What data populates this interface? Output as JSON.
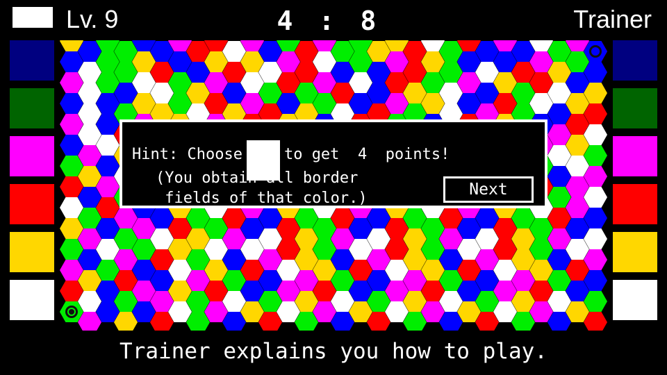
{
  "header": {
    "swatch_color": "#ffffff",
    "level_label": "Lv. 9",
    "score_left": "4",
    "score_separator": ":",
    "score_right": "8",
    "player_name": "Trainer"
  },
  "palette": {
    "colors": [
      "#000080",
      "#006400",
      "#ff00ff",
      "#ff0000",
      "#ffd700",
      "#ffffff"
    ],
    "selected_index": 5,
    "left_items": [
      {
        "name": "swatch-navy",
        "color": "#000080",
        "selected": false
      },
      {
        "name": "swatch-green",
        "color": "#006400",
        "selected": false
      },
      {
        "name": "swatch-magenta",
        "color": "#ff00ff",
        "selected": false
      },
      {
        "name": "swatch-red",
        "color": "#ff0000",
        "selected": false
      },
      {
        "name": "swatch-yellow",
        "color": "#ffd700",
        "selected": false
      },
      {
        "name": "swatch-white",
        "color": "#ffffff",
        "selected": true
      }
    ],
    "right_items": [
      {
        "name": "swatch-navy",
        "color": "#000080",
        "selected": false
      },
      {
        "name": "swatch-green",
        "color": "#006400",
        "selected": false
      },
      {
        "name": "swatch-magenta",
        "color": "#ff00ff",
        "selected": false
      },
      {
        "name": "swatch-red",
        "color": "#ff0000",
        "selected": false
      },
      {
        "name": "swatch-yellow",
        "color": "#ffd700",
        "selected": false
      },
      {
        "name": "swatch-white",
        "color": "#ffffff",
        "selected": false
      }
    ]
  },
  "dialog": {
    "hint_prefix": "Hint:  Choose",
    "hint_swatch_color": "#ffffff",
    "hint_middle": "to get",
    "hint_points": "4",
    "hint_suffix": "points!",
    "explanation": "(You obtain all border\n fields of that color.)",
    "next_label": "Next"
  },
  "footer": {
    "message": "Trainer explains you how to play."
  },
  "board": {
    "hex_colors": {
      "b": "#0000ff",
      "g": "#00ee00",
      "m": "#ff00ff",
      "r": "#ff0000",
      "y": "#ffd700",
      "w": "#ffffff"
    },
    "cols": 30,
    "rows": 14,
    "player_marker": {
      "col": 0,
      "row": 13,
      "style": "ring-dot",
      "color": "#00ee00"
    },
    "opponent_marker": {
      "col": 29,
      "row": 0,
      "style": "ring",
      "color": "#0000ff"
    },
    "grid": [
      "ybgg bmrrwmbgrmggyyrwgrbmbwgmry",
      "bwgg rbbyrywmrwbgbmrygbwbrmygbr",
      "mwgb wgymbwgrgmrwbrygwmbygrwbym",
      "bwbg ygwrymrbygwbrmgywbmrgwbyrm",
      "mwbr gywmbrwygbmrwgybmrwygbmrwg",
      "bmwy rgbmwygrbmwygrbmwygrbmwygr",
      "gybw mrygbwmrygbwmrygbwmrygbwmr",
      "rbmg wybrgmwybrgmwybrgmwybrgmwy",
      "wgrm bygwrmbygwrmbygwrmbygwrmby",
      "ymbg wrygmbwrygmbwrygmbwrygmbwr",
      "gbwm ryg bwmrygbwmrygbwmrygbwmr",
      "mygr bwmygrbwmygrbwmygrbwmygrbw",
      "rwbg mygrwbgmyrwbgmyrwbgmyrwbgm",
      "gmby rwgmbyrwgmbyrwgmbyrwgmbyrw"
    ]
  }
}
